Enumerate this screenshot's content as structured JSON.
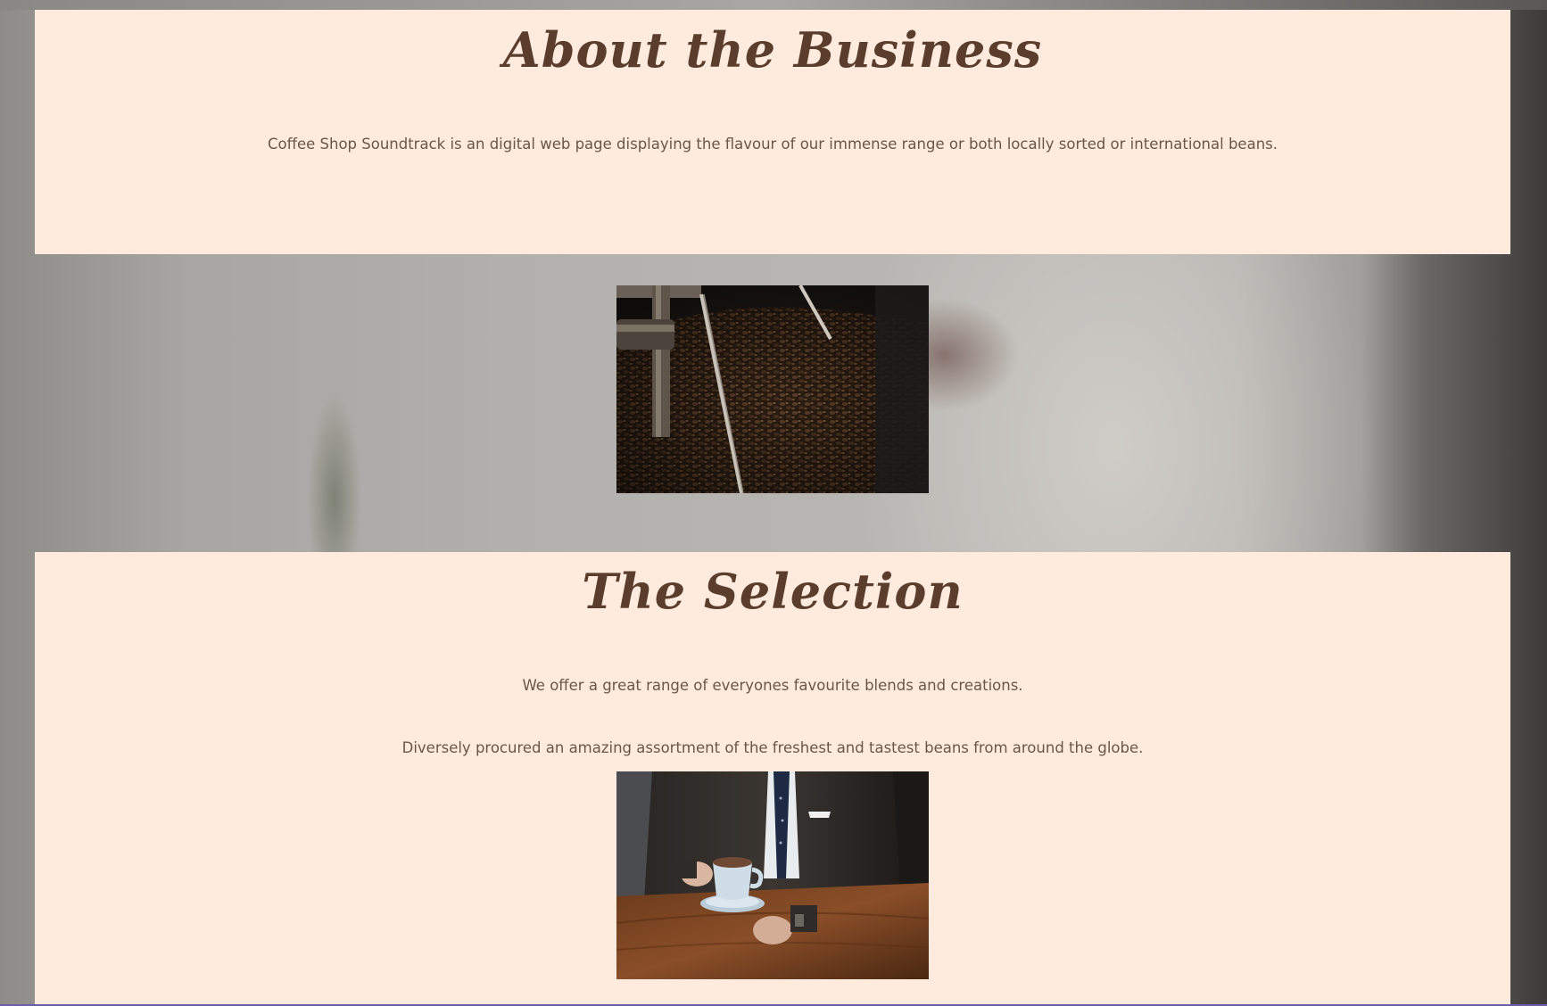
{
  "about": {
    "title": "About the Business",
    "text": "Coffee Shop Soundtrack is an digital web page displaying the flavour of our immense range or both locally sorted or international beans."
  },
  "selection": {
    "title": "The Selection",
    "text_1": "We offer a great range of everyones favourite blends and creations.",
    "text_2": "Diversely procured an amazing assortment of the freshest and tastest beans from around the globe."
  },
  "colors": {
    "panel_background": "#feebdd",
    "heading_color": "#5a3d2c",
    "text_color": "#6a5648"
  }
}
